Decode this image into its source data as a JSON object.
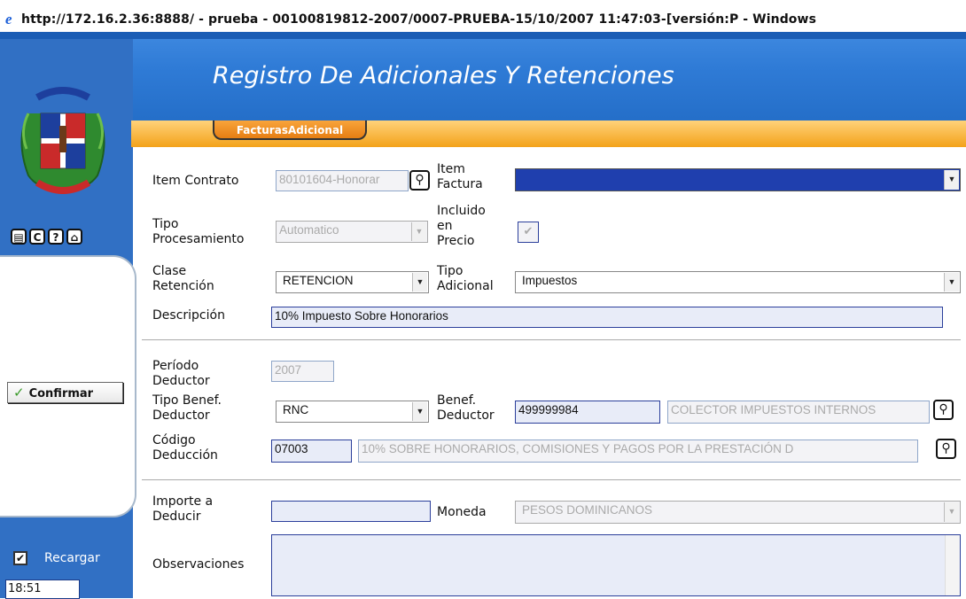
{
  "window": {
    "title": "http://172.16.2.36:8888/ - prueba - 00100819812-2007/0007-PRUEBA-15/10/2007 11:47:03-[versión:P - Windows"
  },
  "header": {
    "title": "Registro De Adicionales Y Retenciones",
    "tab": "FacturasAdicional"
  },
  "sidebar": {
    "confirm_label": "Confirmar",
    "reload_label": "Recargar",
    "reload_checked": "✔",
    "time": "18:51",
    "tools": [
      "doc-icon",
      "refresh-icon",
      "help-icon",
      "home-icon"
    ]
  },
  "form": {
    "item_contrato": {
      "label": "Item Contrato",
      "value": "80101604-Honorar"
    },
    "item_factura": {
      "label": "Item\nFactura",
      "value": ""
    },
    "tipo_procesamiento": {
      "label": "Tipo\nProcesamiento",
      "value": "Automatico"
    },
    "incluido_precio": {
      "label": "Incluido\nen\nPrecio",
      "checked": "✔"
    },
    "clase_retencion": {
      "label": "Clase\nRetención",
      "value": "RETENCION"
    },
    "tipo_adicional": {
      "label": "Tipo\nAdicional",
      "value": "Impuestos"
    },
    "descripcion": {
      "label": "Descripción",
      "value": "10% Impuesto Sobre Honorarios"
    },
    "periodo_deductor": {
      "label": "Período\nDeductor",
      "value": "2007"
    },
    "tipo_benef_deductor": {
      "label": "Tipo Benef.\nDeductor",
      "value": "RNC"
    },
    "benef_deductor": {
      "label": "Benef.\nDeductor",
      "value": "499999984",
      "name": "COLECTOR IMPUESTOS INTERNOS"
    },
    "codigo_deduccion": {
      "label": "Código\nDeducción",
      "value": "07003",
      "description": "10% SOBRE HONORARIOS, COMISIONES Y PAGOS POR LA PRESTACIÓN D"
    },
    "importe_deducir": {
      "label": "Importe a\nDeducir",
      "value": ""
    },
    "moneda": {
      "label": "Moneda",
      "value": "PESOS DOMINICANOS"
    },
    "observaciones": {
      "label": "Observaciones",
      "value": ""
    }
  },
  "colors": {
    "banner": "#2f7bd6",
    "tab": "#f39a2a",
    "field_bg": "#e8ecf8",
    "field_border": "#2b3f9b",
    "selected": "#1f3fae"
  }
}
